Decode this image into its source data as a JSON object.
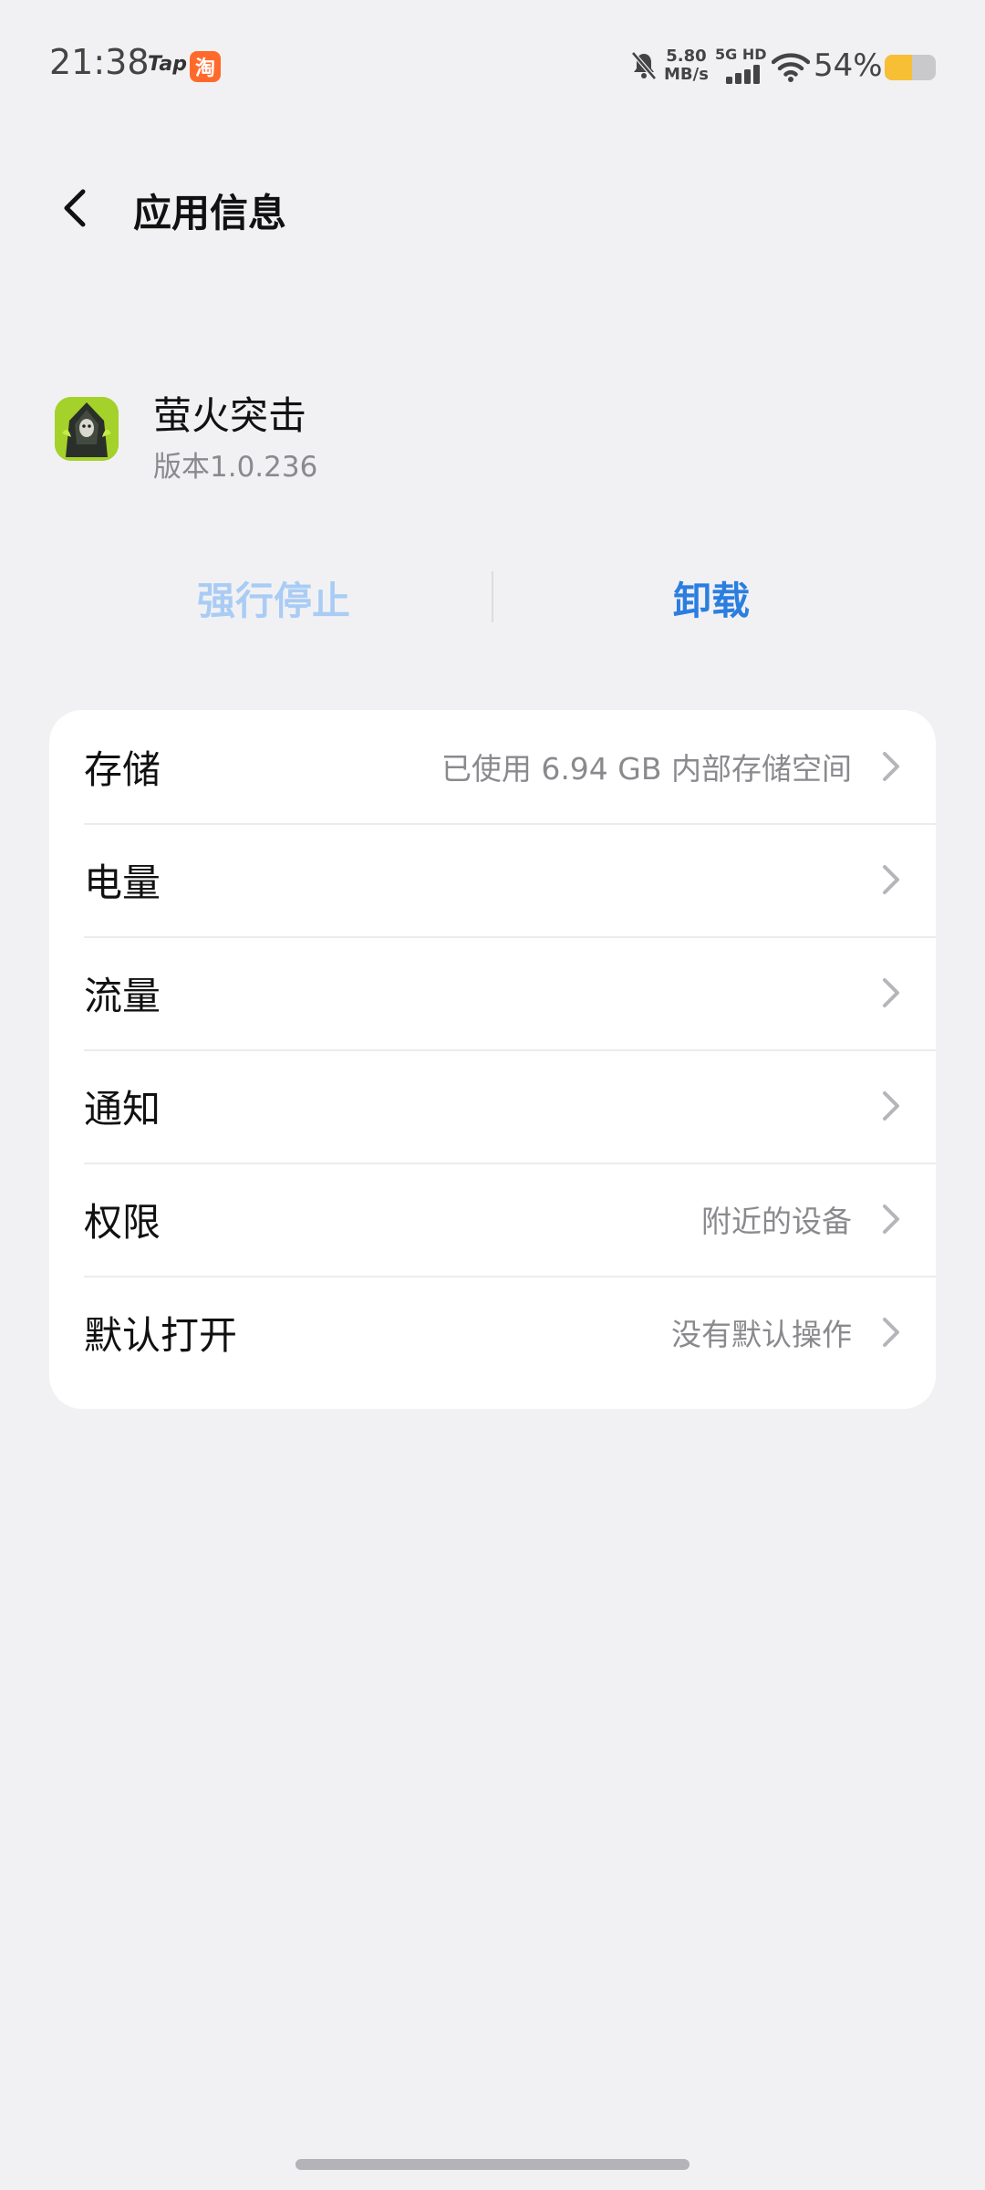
{
  "status_bar": {
    "time": "21:38",
    "tap_label": "Tap",
    "taobao_label": "淘",
    "net_speed_value": "5.80",
    "net_speed_unit": "MB/s",
    "network_type": "5G HD",
    "battery_percent": "54%",
    "battery_level": 0.54,
    "icons": [
      "bell-muted-icon",
      "signal-icon",
      "wifi-icon",
      "battery-icon"
    ]
  },
  "header": {
    "title": "应用信息",
    "back_icon": "chevron-left-icon"
  },
  "app": {
    "name": "萤火突击",
    "version": "版本1.0.236",
    "icon": "app-icon"
  },
  "actions": {
    "force_stop_label": "强行停止",
    "uninstall_label": "卸载"
  },
  "settings": {
    "items": [
      {
        "label": "存储",
        "value": "已使用 6.94 GB 内部存储空间"
      },
      {
        "label": "电量",
        "value": ""
      },
      {
        "label": "流量",
        "value": ""
      },
      {
        "label": "通知",
        "value": ""
      },
      {
        "label": "权限",
        "value": "附近的设备"
      },
      {
        "label": "默认打开",
        "value": "没有默认操作"
      }
    ]
  },
  "colors": {
    "background": "#f1f1f4",
    "accent": "#2b7ee0",
    "accent_disabled": "#a9ccf4",
    "battery": "#f6bf35"
  }
}
